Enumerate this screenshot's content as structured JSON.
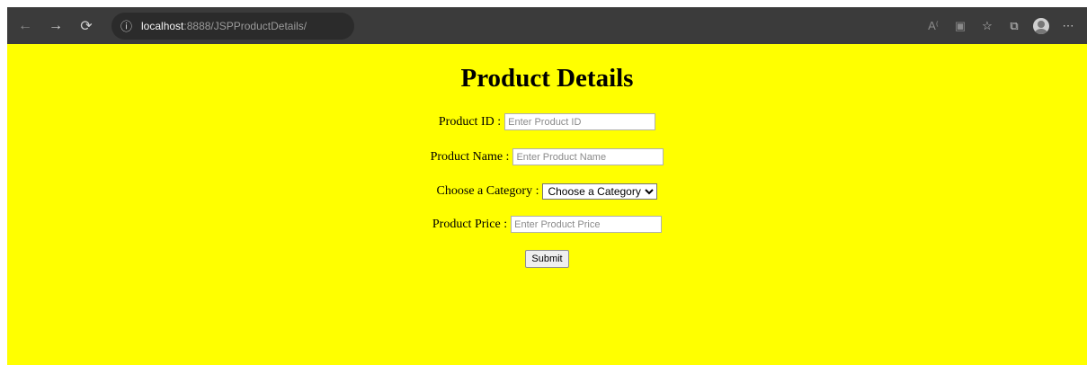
{
  "browser": {
    "url_host": "localhost",
    "url_path": ":8888/JSPProductDetails/",
    "back_icon": "arrow-left-icon",
    "forward_icon": "arrow-right-icon",
    "refresh_icon": "refresh-icon"
  },
  "page": {
    "title": "Product Details",
    "background_color": "#ffff00",
    "fields": {
      "product_id": {
        "label": "Product ID :",
        "placeholder": "Enter Product ID",
        "value": ""
      },
      "product_name": {
        "label": "Product Name :",
        "placeholder": "Enter Product Name",
        "value": ""
      },
      "category": {
        "label": "Choose a Category :",
        "selected": "Choose a Category"
      },
      "product_price": {
        "label": "Product Price :",
        "placeholder": "Enter Product Price",
        "value": ""
      }
    },
    "submit_label": "Submit"
  }
}
